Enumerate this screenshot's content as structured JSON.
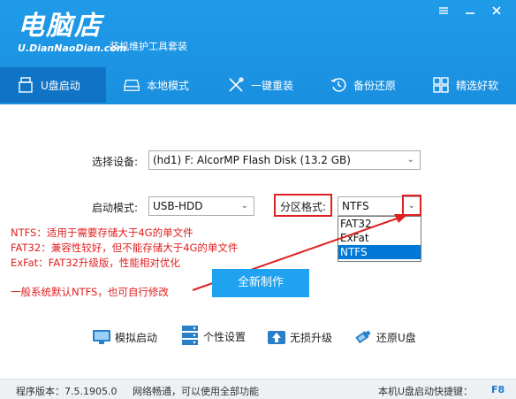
{
  "header": {
    "logo_main": "电脑店",
    "logo_sub": "U.DianNaoDian.com",
    "slogan": "装机维护工具套装",
    "window_buttons": [
      "minimize-icon",
      "close-icon"
    ]
  },
  "nav": [
    {
      "label": "U盘启动",
      "icon": "usb-drive-icon",
      "active": true
    },
    {
      "label": "本地模式",
      "icon": "hard-disk-icon",
      "active": false
    },
    {
      "label": "一键重装",
      "icon": "tools-icon",
      "active": false
    },
    {
      "label": "备份还原",
      "icon": "restore-icon",
      "active": false
    },
    {
      "label": "精选好软",
      "icon": "apps-grid-icon",
      "active": false
    }
  ],
  "form": {
    "device_label": "选择设备:",
    "device_value": "(hd1) F: AlcorMP Flash Disk (13.2 GB)",
    "boot_mode_label": "启动模式:",
    "boot_mode_value": "USB-HDD",
    "partition_label": "分区格式:",
    "partition_value": "NTFS",
    "partition_options": [
      "FAT32",
      "ExFat",
      "NTFS"
    ],
    "partition_selected": "NTFS"
  },
  "notes": {
    "ntfs": "NTFS：适用于需要存储大于4G的单文件",
    "fat32": "FAT32：兼容性较好，但不能存储大于4G的单文件",
    "exfat": "ExFat：FAT32升级版，性能相对优化",
    "default": "一般系统默认NTFS，也可自行修改"
  },
  "primary_button": "全新制作",
  "tools": [
    {
      "label": "模拟启动",
      "icon": "monitor-icon"
    },
    {
      "label": "个性设置",
      "icon": "server-settings-icon"
    },
    {
      "label": "无损升级",
      "icon": "upgrade-icon"
    },
    {
      "label": "还原U盘",
      "icon": "usb-restore-icon"
    }
  ],
  "status": {
    "version": "程序版本：7.5.1905.0",
    "network": "网络畅通，可以使用全部功能",
    "hotkey_label": "本机U盘启动快捷键：",
    "hotkey": "F8"
  },
  "colors": {
    "header_blue": "#1f9be8",
    "nav_active": "#0f74c6",
    "annotation_red": "#e02020",
    "primary_button": "#1fa2f0",
    "selection": "#0078d7"
  }
}
